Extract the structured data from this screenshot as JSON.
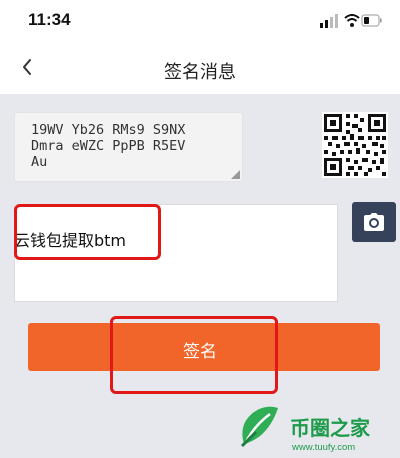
{
  "status_bar": {
    "time": "11:34"
  },
  "nav": {
    "title": "签名消息"
  },
  "address": {
    "lines": [
      "19WV Yb26 RMs9 S9NX",
      "Dmra eWZC PpPB R5EV",
      "Au"
    ]
  },
  "message": {
    "value": "云钱包提取btm"
  },
  "sign_button": {
    "label": "签名"
  },
  "watermark": {
    "title": "币圈之家",
    "url": "www.tuufy.com"
  },
  "colors": {
    "accent": "#f1642a",
    "camera_bg": "#35425a",
    "highlight": "#e01818",
    "page_bg": "#e7e8ee"
  },
  "icons": [
    "back-icon",
    "qr-code-icon",
    "camera-icon",
    "signal-icon",
    "wifi-icon",
    "battery-icon"
  ]
}
